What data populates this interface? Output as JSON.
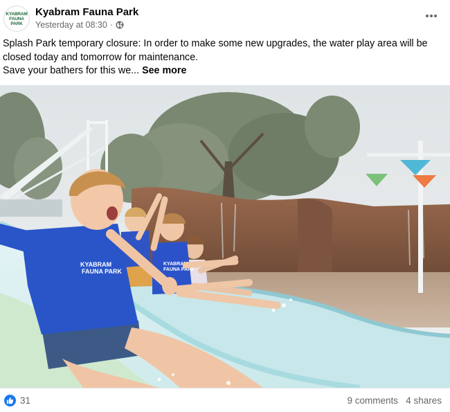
{
  "post": {
    "page_name": "Kyabram Fauna Park",
    "logo_text_1": "KYABRAM",
    "logo_text_2": "FAUNA PARK",
    "timestamp": "Yesterday at 08:30",
    "meta_separator": "·",
    "privacy_icon": "globe-icon",
    "more_icon": "ellipsis-icon",
    "text_line_1": "Splash Park temporary closure: In order to make some new upgrades, the water play area will be closed today and tomorrow for maintenance.",
    "text_line_2": "Save your bathers for this we...",
    "see_more": "See more"
  },
  "photo": {
    "shirt_text_1": "KYABRAM",
    "shirt_text_2": "FAUNA PARK",
    "shirt_text_small_1": "KYABRAM",
    "shirt_text_small_2": "FAUNA PARK"
  },
  "footer": {
    "like_icon": "thumbs-up-icon",
    "reactions_count": "31",
    "comments": "9 comments",
    "shares": "4 shares"
  },
  "colors": {
    "brand_blue": "#1877f2",
    "secondary_text": "#65676b"
  }
}
